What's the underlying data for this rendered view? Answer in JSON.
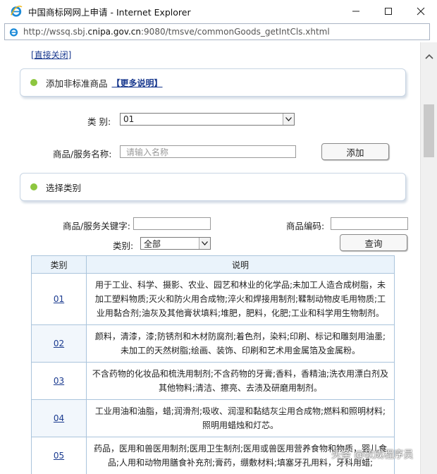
{
  "window": {
    "title": "中国商标网网上申请 - Internet Explorer",
    "url_prefix": "http://wssq.sbj.",
    "url_domain": "cnipa.gov.cn",
    "url_suffix": ":9080/tmsve/commonGoods_getIntCls.xhtml"
  },
  "page": {
    "close_link": "[直接关闭]",
    "add_section": {
      "title": "添加非标准商品",
      "more_link": "【更多说明】"
    },
    "category_label": "类  别:",
    "category_value": "01",
    "name_label": "商品/服务名称:",
    "name_placeholder": "请输入名称",
    "add_button": "添加",
    "select_section": {
      "title": "选择类别"
    },
    "keyword_label": "商品/服务关键字:",
    "code_label": "商品编码:",
    "filter_category_label": "类别:",
    "filter_category_value": "全部",
    "search_button": "查询"
  },
  "table": {
    "headers": [
      "类别",
      "说明"
    ],
    "rows": [
      {
        "code": "01",
        "desc": "用于工业、科学、摄影、农业、园艺和林业的化学品;未加工人造合成树脂，未加工塑料物质;灭火和防火用合成物;淬火和焊接用制剂;鞣制动物皮毛用物质;工业用黏合剂;油灰及其他膏状填料;堆肥，肥料，化肥;工业和科学用生物制剂。"
      },
      {
        "code": "02",
        "desc": "颜料，清漆，漆;防锈剂和木材防腐剂;着色剂，染料;印刷、标记和雕刻用油墨;未加工的天然树脂;绘画、装饰、印刷和艺术用金属箔及金属粉。"
      },
      {
        "code": "03",
        "desc": "不含药物的化妆品和梳洗用制剂;不含药物的牙膏;香料，香精油;洗衣用漂白剂及其他物料;清洁、擦亮、去渍及研磨用制剂。"
      },
      {
        "code": "04",
        "desc": "工业用油和油脂，蜡;润滑剂;吸收、润湿和黏结灰尘用合成物;燃料和照明材料;照明用蜡烛和灯芯。"
      },
      {
        "code": "05",
        "desc": "药品，医用和兽医用制剂;医用卫生制剂;医用或兽医用营养食物和物质，婴儿食品;人用和动物用膳食补充剂;膏药，绷敷材料;填塞牙孔用料，牙科用蜡;"
      }
    ]
  },
  "watermark": "头条 @软成程序员"
}
